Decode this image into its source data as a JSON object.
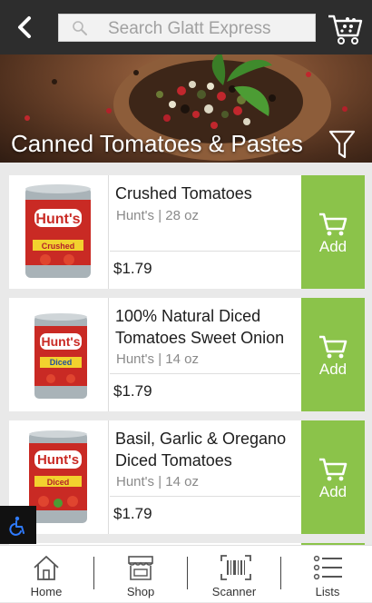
{
  "header": {
    "back_icon": "chevron-left-icon",
    "search_placeholder": "Search Glatt Express",
    "cart_icon": "shopping-cart-icon"
  },
  "banner": {
    "title": "Canned Tomatoes & Pastes",
    "filter_icon": "filter-icon"
  },
  "products": [
    {
      "name": "Crushed Tomatoes",
      "brand": "Hunt's",
      "size": "28 oz",
      "meta": "Hunt's | 28 oz",
      "price": "$1.79",
      "image_label": "Hunt's",
      "image_variant": "Crushed",
      "add_label": "Add"
    },
    {
      "name": "100% Natural Diced Tomatoes Sweet Onion",
      "brand": "Hunt's",
      "size": "14 oz",
      "meta": "Hunt's | 14 oz",
      "price": "$1.79",
      "image_label": "Hunt's",
      "image_variant": "Diced",
      "add_label": "Add"
    },
    {
      "name": "Basil, Garlic & Oregano Diced Tomatoes",
      "brand": "Hunt's",
      "size": "14 oz",
      "meta": "Hunt's | 14 oz",
      "price": "$1.79",
      "image_label": "Hunt's",
      "image_variant": "Diced",
      "add_label": "Add"
    }
  ],
  "tabs": [
    {
      "label": "Home",
      "icon": "home-icon"
    },
    {
      "label": "Shop",
      "icon": "store-icon"
    },
    {
      "label": "Scanner",
      "icon": "barcode-icon"
    },
    {
      "label": "Lists",
      "icon": "list-icon"
    }
  ],
  "colors": {
    "header_bg": "#2d2d2d",
    "add_button": "#8bc34a",
    "page_bg": "#e9e9e9",
    "accessibility_bg": "#111111"
  }
}
